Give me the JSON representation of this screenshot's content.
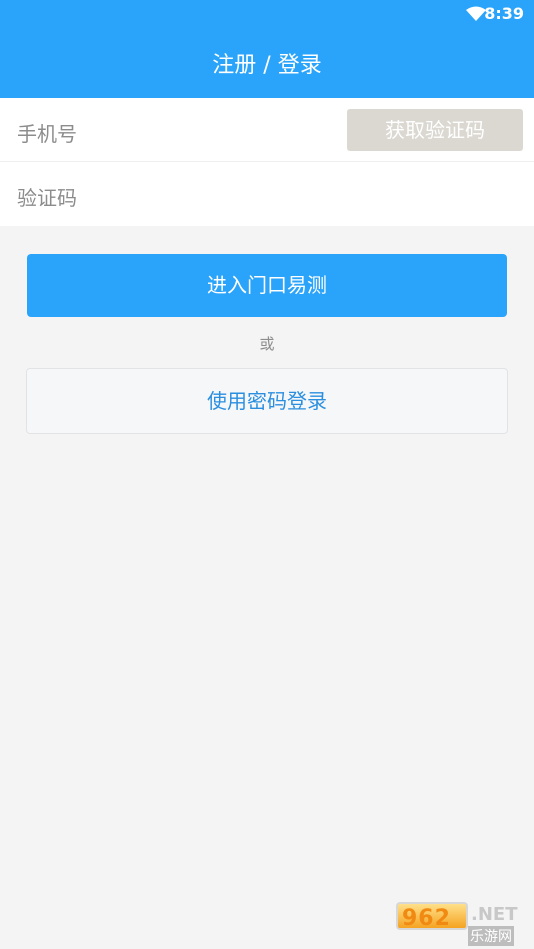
{
  "status_bar": {
    "time": "8:39",
    "wifi_icon": "wifi-icon"
  },
  "header": {
    "title": "注册 / 登录",
    "background_color": "#2aa3fb"
  },
  "form": {
    "phone_label": "手机号",
    "code_button": "获取验证码",
    "verify_label": "验证码"
  },
  "actions": {
    "primary_label": "进入门口易测",
    "or_text": "或",
    "secondary_label": "使用密码登录"
  },
  "watermark": {
    "number": "962",
    "suffix": ".NET",
    "cn": "乐游网"
  },
  "colors": {
    "accent": "#2aa3fb",
    "disabled_button": "#dbd8d2",
    "link_text": "#2b8fe0"
  }
}
